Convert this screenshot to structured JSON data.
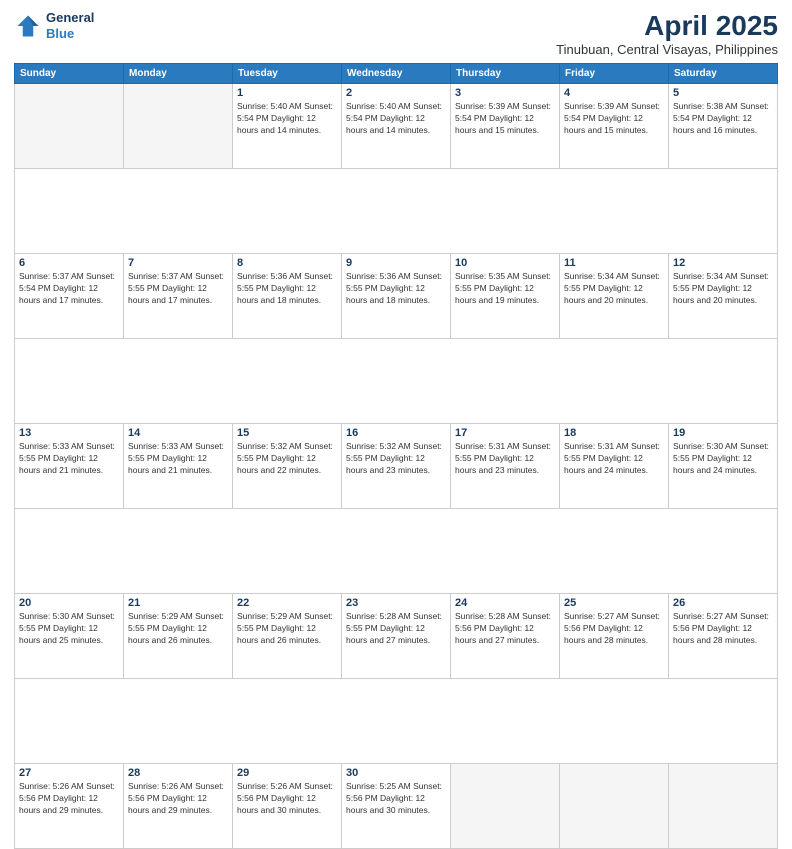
{
  "header": {
    "logo_line1": "General",
    "logo_line2": "Blue",
    "title": "April 2025",
    "subtitle": "Tinubuan, Central Visayas, Philippines"
  },
  "days_of_week": [
    "Sunday",
    "Monday",
    "Tuesday",
    "Wednesday",
    "Thursday",
    "Friday",
    "Saturday"
  ],
  "weeks": [
    [
      {
        "num": "",
        "info": ""
      },
      {
        "num": "",
        "info": ""
      },
      {
        "num": "1",
        "info": "Sunrise: 5:40 AM\nSunset: 5:54 PM\nDaylight: 12 hours and 14 minutes."
      },
      {
        "num": "2",
        "info": "Sunrise: 5:40 AM\nSunset: 5:54 PM\nDaylight: 12 hours and 14 minutes."
      },
      {
        "num": "3",
        "info": "Sunrise: 5:39 AM\nSunset: 5:54 PM\nDaylight: 12 hours and 15 minutes."
      },
      {
        "num": "4",
        "info": "Sunrise: 5:39 AM\nSunset: 5:54 PM\nDaylight: 12 hours and 15 minutes."
      },
      {
        "num": "5",
        "info": "Sunrise: 5:38 AM\nSunset: 5:54 PM\nDaylight: 12 hours and 16 minutes."
      }
    ],
    [
      {
        "num": "6",
        "info": "Sunrise: 5:37 AM\nSunset: 5:54 PM\nDaylight: 12 hours and 17 minutes."
      },
      {
        "num": "7",
        "info": "Sunrise: 5:37 AM\nSunset: 5:55 PM\nDaylight: 12 hours and 17 minutes."
      },
      {
        "num": "8",
        "info": "Sunrise: 5:36 AM\nSunset: 5:55 PM\nDaylight: 12 hours and 18 minutes."
      },
      {
        "num": "9",
        "info": "Sunrise: 5:36 AM\nSunset: 5:55 PM\nDaylight: 12 hours and 18 minutes."
      },
      {
        "num": "10",
        "info": "Sunrise: 5:35 AM\nSunset: 5:55 PM\nDaylight: 12 hours and 19 minutes."
      },
      {
        "num": "11",
        "info": "Sunrise: 5:34 AM\nSunset: 5:55 PM\nDaylight: 12 hours and 20 minutes."
      },
      {
        "num": "12",
        "info": "Sunrise: 5:34 AM\nSunset: 5:55 PM\nDaylight: 12 hours and 20 minutes."
      }
    ],
    [
      {
        "num": "13",
        "info": "Sunrise: 5:33 AM\nSunset: 5:55 PM\nDaylight: 12 hours and 21 minutes."
      },
      {
        "num": "14",
        "info": "Sunrise: 5:33 AM\nSunset: 5:55 PM\nDaylight: 12 hours and 21 minutes."
      },
      {
        "num": "15",
        "info": "Sunrise: 5:32 AM\nSunset: 5:55 PM\nDaylight: 12 hours and 22 minutes."
      },
      {
        "num": "16",
        "info": "Sunrise: 5:32 AM\nSunset: 5:55 PM\nDaylight: 12 hours and 23 minutes."
      },
      {
        "num": "17",
        "info": "Sunrise: 5:31 AM\nSunset: 5:55 PM\nDaylight: 12 hours and 23 minutes."
      },
      {
        "num": "18",
        "info": "Sunrise: 5:31 AM\nSunset: 5:55 PM\nDaylight: 12 hours and 24 minutes."
      },
      {
        "num": "19",
        "info": "Sunrise: 5:30 AM\nSunset: 5:55 PM\nDaylight: 12 hours and 24 minutes."
      }
    ],
    [
      {
        "num": "20",
        "info": "Sunrise: 5:30 AM\nSunset: 5:55 PM\nDaylight: 12 hours and 25 minutes."
      },
      {
        "num": "21",
        "info": "Sunrise: 5:29 AM\nSunset: 5:55 PM\nDaylight: 12 hours and 26 minutes."
      },
      {
        "num": "22",
        "info": "Sunrise: 5:29 AM\nSunset: 5:55 PM\nDaylight: 12 hours and 26 minutes."
      },
      {
        "num": "23",
        "info": "Sunrise: 5:28 AM\nSunset: 5:55 PM\nDaylight: 12 hours and 27 minutes."
      },
      {
        "num": "24",
        "info": "Sunrise: 5:28 AM\nSunset: 5:56 PM\nDaylight: 12 hours and 27 minutes."
      },
      {
        "num": "25",
        "info": "Sunrise: 5:27 AM\nSunset: 5:56 PM\nDaylight: 12 hours and 28 minutes."
      },
      {
        "num": "26",
        "info": "Sunrise: 5:27 AM\nSunset: 5:56 PM\nDaylight: 12 hours and 28 minutes."
      }
    ],
    [
      {
        "num": "27",
        "info": "Sunrise: 5:26 AM\nSunset: 5:56 PM\nDaylight: 12 hours and 29 minutes."
      },
      {
        "num": "28",
        "info": "Sunrise: 5:26 AM\nSunset: 5:56 PM\nDaylight: 12 hours and 29 minutes."
      },
      {
        "num": "29",
        "info": "Sunrise: 5:26 AM\nSunset: 5:56 PM\nDaylight: 12 hours and 30 minutes."
      },
      {
        "num": "30",
        "info": "Sunrise: 5:25 AM\nSunset: 5:56 PM\nDaylight: 12 hours and 30 minutes."
      },
      {
        "num": "",
        "info": ""
      },
      {
        "num": "",
        "info": ""
      },
      {
        "num": "",
        "info": ""
      }
    ]
  ]
}
